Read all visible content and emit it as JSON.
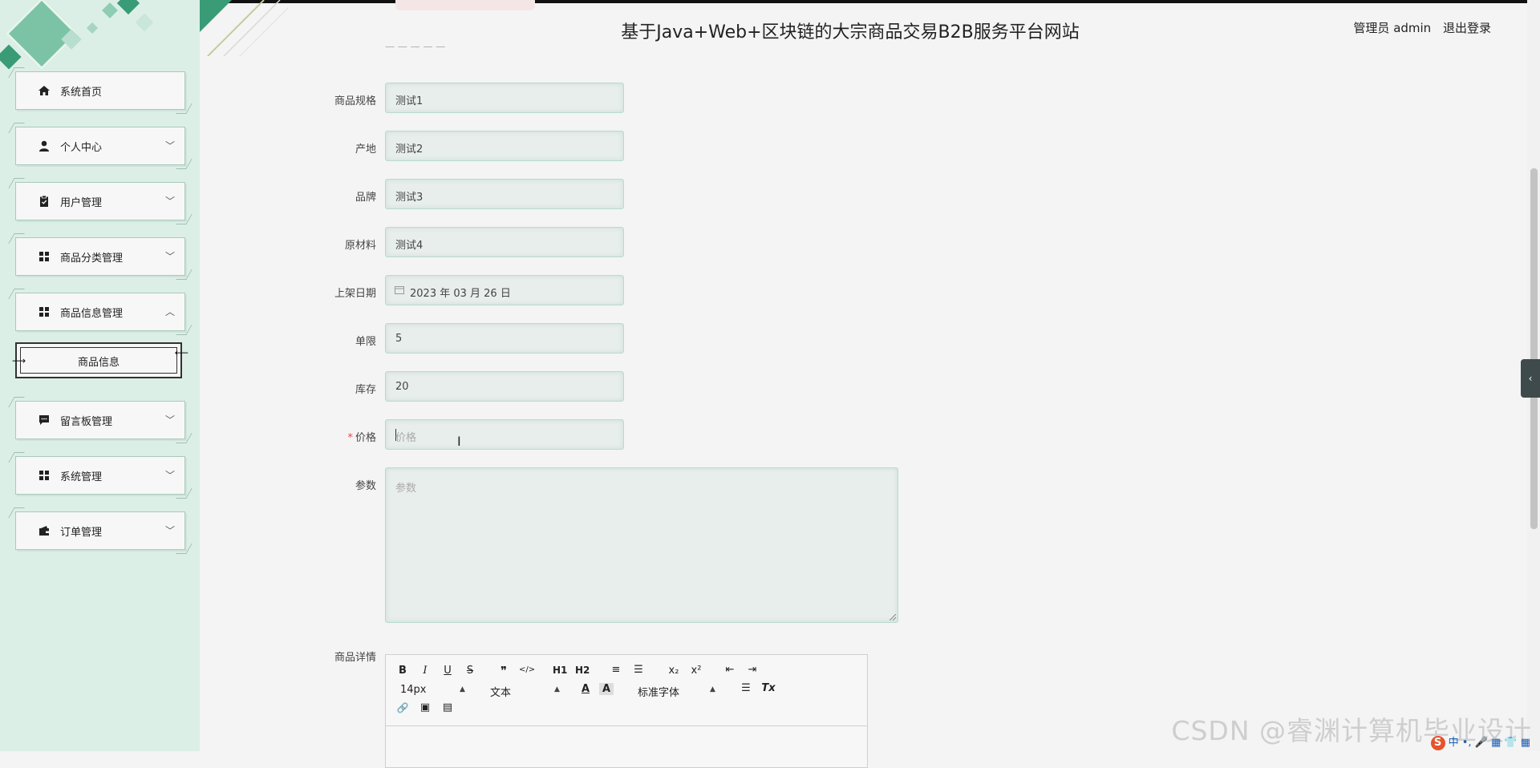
{
  "header": {
    "title": "基于Java+Web+区块链的大宗商品交易B2B服务平台网站",
    "role": "管理员 admin",
    "logout": "退出登录"
  },
  "sidebar": {
    "items": [
      {
        "label": "系统首页",
        "icon": "home-icon",
        "chevron": ""
      },
      {
        "label": "个人中心",
        "icon": "user-icon",
        "chevron": "﹀"
      },
      {
        "label": "用户管理",
        "icon": "clipboard-icon",
        "chevron": "﹀"
      },
      {
        "label": "商品分类管理",
        "icon": "grid-icon",
        "chevron": "﹀"
      },
      {
        "label": "商品信息管理",
        "icon": "grid-icon",
        "chevron": "︿"
      },
      {
        "label": "留言板管理",
        "icon": "message-icon",
        "chevron": "﹀"
      },
      {
        "label": "系统管理",
        "icon": "grid-icon",
        "chevron": "﹀"
      },
      {
        "label": "订单管理",
        "icon": "wallet-icon",
        "chevron": "﹀"
      }
    ],
    "subitem": "商品信息"
  },
  "form": {
    "fields": [
      {
        "label": "商品规格",
        "value": "测试1"
      },
      {
        "label": "产地",
        "value": "测试2"
      },
      {
        "label": "品牌",
        "value": "测试3"
      },
      {
        "label": "原材料",
        "value": "测试4"
      },
      {
        "label": "上架日期",
        "value": "2023 年 03 月 26 日"
      },
      {
        "label": "单限",
        "value": "5"
      },
      {
        "label": "库存",
        "value": "20"
      },
      {
        "label": "价格",
        "placeholder": "价格",
        "required_mark": "*"
      }
    ],
    "params": {
      "label": "参数",
      "placeholder": "参数"
    },
    "details": {
      "label": "商品详情"
    }
  },
  "editor": {
    "row1": [
      "B",
      "I",
      "U",
      "S",
      "❞",
      "</>",
      "H1",
      "H2",
      "≡",
      "☰",
      "x₂",
      "x²",
      "⇤",
      "⇥"
    ],
    "font_size": "14px",
    "block": "文本",
    "font_family": "标准字体",
    "row3": [
      "🔗",
      "▣",
      "▤"
    ]
  },
  "watermark": "CSDN @睿渊计算机毕业设计",
  "ime": {
    "logo": "S",
    "text": "中 •, 🎤 ▦ 👕 ▦"
  },
  "colors": {
    "sidebar_bg": "#dcefe7",
    "accent_green": "#3a9b77",
    "field_border": "#b9dccd",
    "required": "#e04b4b"
  }
}
